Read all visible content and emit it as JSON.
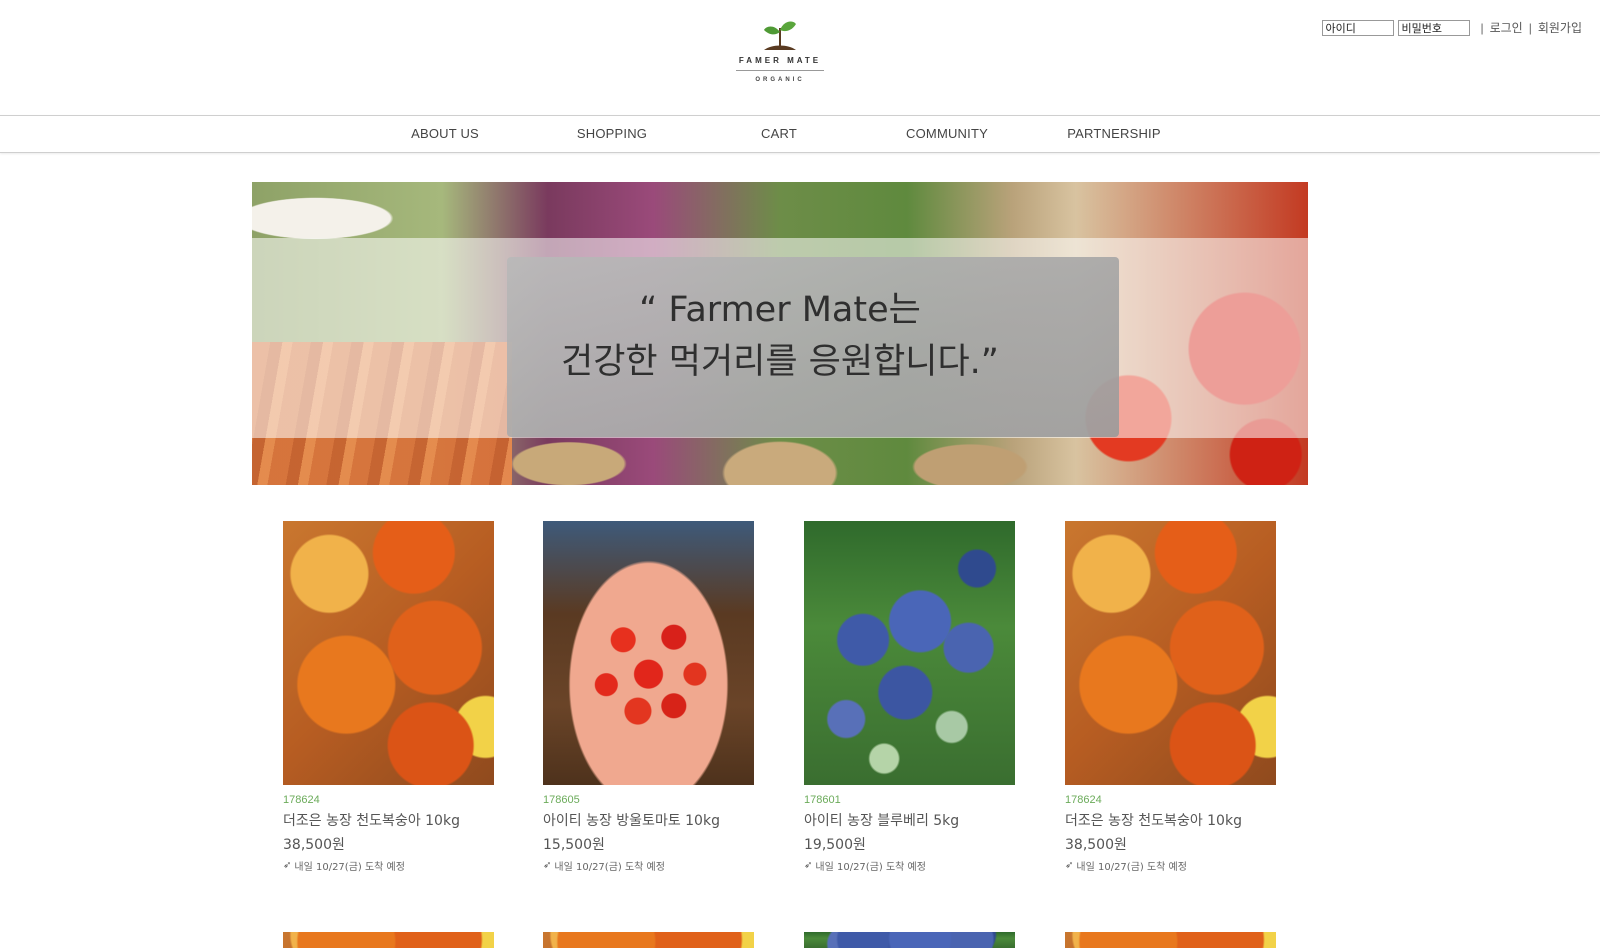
{
  "header": {
    "logo": {
      "brand": "FAMER MATE",
      "sub": "ORGANIC"
    },
    "login": {
      "id_field": "아이디",
      "password_field": "비밀번호",
      "login_link": "로그인",
      "signup_link": "회원가입",
      "separator": "|"
    }
  },
  "nav": {
    "items": [
      {
        "label": "ABOUT US"
      },
      {
        "label": "SHOPPING"
      },
      {
        "label": "CART"
      },
      {
        "label": "COMMUNITY"
      },
      {
        "label": "PARTNERSHIP"
      }
    ]
  },
  "banner": {
    "line1": "“ Farmer Mate는",
    "line2": "건강한 먹거리를 응원합니다.”"
  },
  "products": [
    {
      "code": "178624",
      "name": "더조은 농장 천도복숭아 10kg",
      "price": "38,500원",
      "shipping": "내일 10/27(금) 도착 예정",
      "image": "peach"
    },
    {
      "code": "178605",
      "name": "아이티 농장 방울토마토 10kg",
      "price": "15,500원",
      "shipping": "내일 10/27(금) 도착 예정",
      "image": "cherry-tomato"
    },
    {
      "code": "178601",
      "name": "아이티 농장 블루베리 5kg",
      "price": "19,500원",
      "shipping": "내일 10/27(금) 도착 예정",
      "image": "blueberry"
    },
    {
      "code": "178624",
      "name": "더조은 농장 천도복숭아 10kg",
      "price": "38,500원",
      "shipping": "내일 10/27(금) 도착 예정",
      "image": "peach"
    }
  ],
  "icons": {
    "ship": "rocket-icon",
    "logo": "sprout-icon"
  },
  "colors": {
    "accent_green": "#6bab5a",
    "text": "#555555"
  }
}
